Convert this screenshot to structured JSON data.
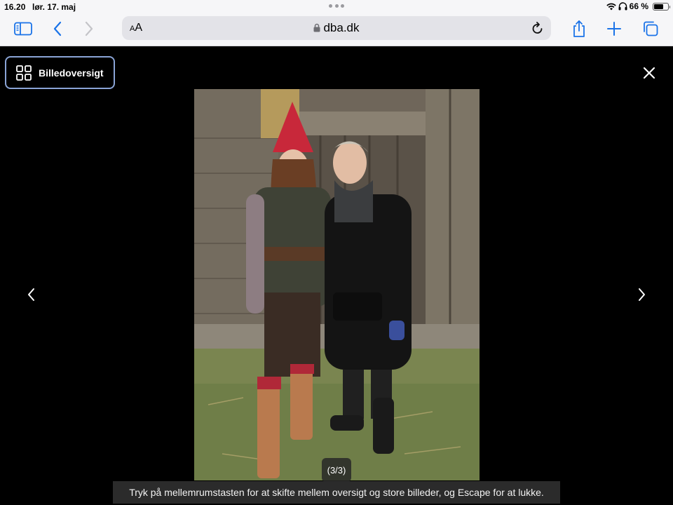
{
  "status_bar": {
    "time": "16.20",
    "date": "lør. 17. maj",
    "battery_text": "66 %",
    "battery_level": 0.66,
    "icons": [
      "wifi-icon",
      "headphones-icon",
      "battery-icon"
    ]
  },
  "toolbar": {
    "text_size_label_small": "A",
    "text_size_label_large": "A",
    "url": "dba.dk",
    "icons": [
      "sidebar-icon",
      "back-icon",
      "forward-icon",
      "lock-icon",
      "reload-icon",
      "share-icon",
      "plus-icon",
      "tabs-icon"
    ]
  },
  "viewer": {
    "overview_label": "Billedoversigt",
    "counter": "(3/3)",
    "hint": "Tryk på mellemrumstasten for at skifte mellem oversigt og store billeder, og Escape for at lukke.",
    "icons": [
      "grid-icon",
      "close-icon",
      "prev-arrow-icon",
      "next-arrow-icon"
    ]
  },
  "colors": {
    "toolbar_bg": "#f6f6f8",
    "accent": "#1a73e8",
    "viewer_bg": "#000000",
    "overview_border": "#8aa4d6"
  }
}
